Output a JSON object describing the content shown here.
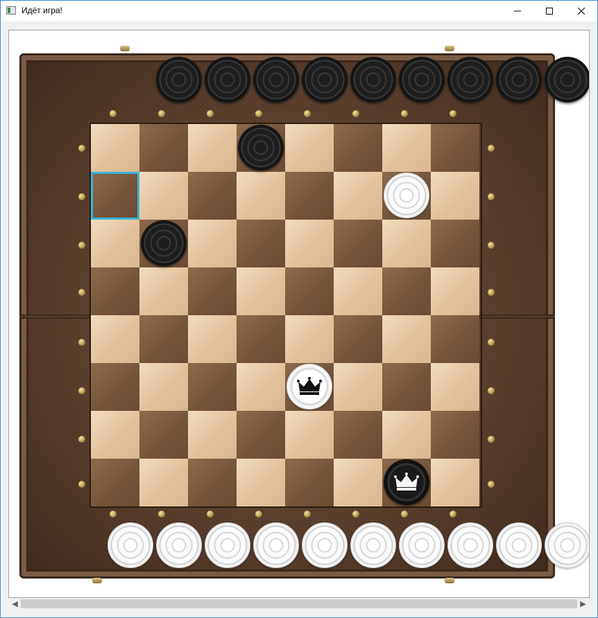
{
  "window": {
    "title": "Идёт игра!",
    "controls": [
      "minimize",
      "maximize",
      "close"
    ]
  },
  "board": {
    "rows": 8,
    "cols": 8,
    "selected_cell": {
      "row": 2,
      "col": 1
    },
    "pieces_on_board": [
      {
        "row": 1,
        "col": 4,
        "color": "black",
        "king": false
      },
      {
        "row": 2,
        "col": 7,
        "color": "white",
        "king": false
      },
      {
        "row": 3,
        "col": 2,
        "color": "black",
        "king": false
      },
      {
        "row": 6,
        "col": 5,
        "color": "white",
        "king": true
      },
      {
        "row": 8,
        "col": 7,
        "color": "black",
        "king": true
      }
    ]
  },
  "captured": {
    "black_count": 9,
    "white_count": 10
  },
  "colors": {
    "selection": "#3bb3d8"
  }
}
